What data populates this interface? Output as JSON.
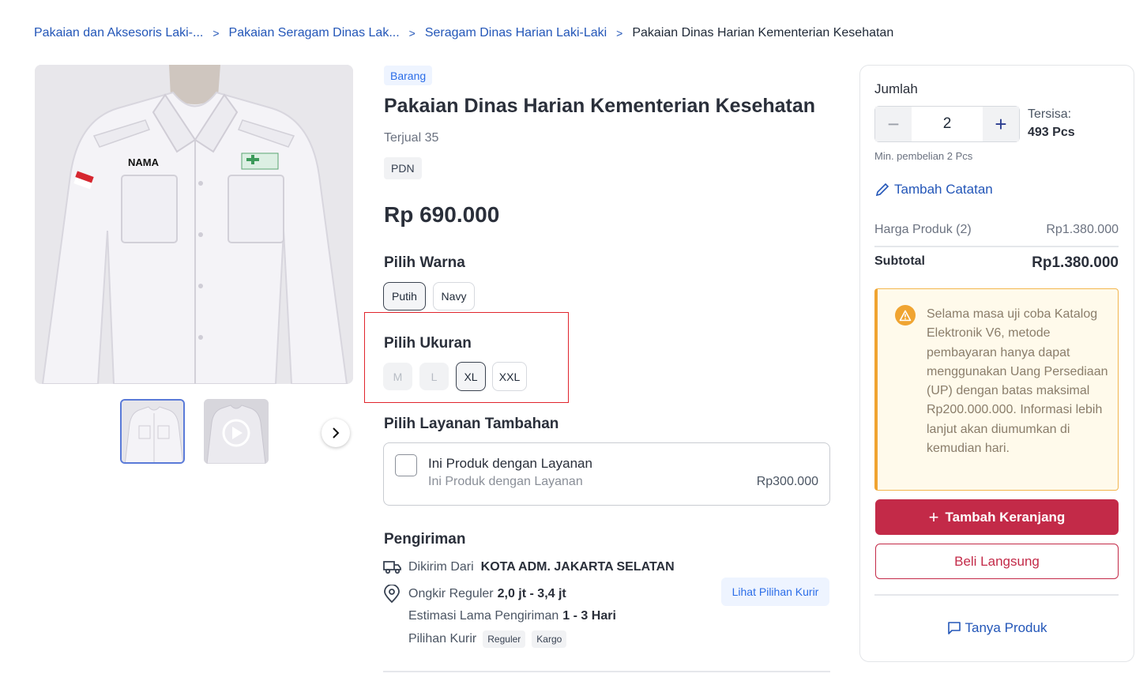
{
  "breadcrumb": {
    "items": [
      "Pakaian dan Aksesoris Laki-...",
      "Pakaian Seragam Dinas Lak...",
      "Seragam Dinas Harian Laki-Laki"
    ],
    "current": "Pakaian Dinas Harian Kementerian Kesehatan",
    "separator": ">"
  },
  "gallery": {
    "image_label": "NAMA",
    "thumbnails": [
      "photo",
      "video"
    ],
    "next_icon": "chevron-right-icon"
  },
  "product": {
    "type_tag": "Barang",
    "title": "Pakaian Dinas Harian Kementerian Kesehatan",
    "sold": "Terjual 35",
    "tag": "PDN",
    "price": "Rp 690.000"
  },
  "color": {
    "label": "Pilih Warna",
    "options": [
      "Putih",
      "Navy"
    ],
    "selected": "Putih"
  },
  "size": {
    "label": "Pilih Ukuran",
    "options": [
      "M",
      "L",
      "XL",
      "XXL"
    ],
    "disabled": [
      "M",
      "L"
    ],
    "selected": "XL"
  },
  "service": {
    "label": "Pilih Layanan Tambahan",
    "name": "Ini Produk dengan Layanan",
    "description": "Ini Produk dengan Layanan",
    "price": "Rp300.000"
  },
  "shipping": {
    "label": "Pengiriman",
    "from_label": "Dikirim Dari",
    "from_value": "KOTA ADM. JAKARTA SELATAN",
    "cost_label": "Ongkir Reguler",
    "cost_value": "2,0 jt - 3,4 jt",
    "estimate_label": "Estimasi Lama Pengiriman",
    "estimate_value": "1 - 3 Hari",
    "courier_label": "Pilihan Kurir",
    "couriers": [
      "Reguler",
      "Kargo"
    ],
    "courier_button": "Lihat Pilihan Kurir"
  },
  "cart": {
    "qty_label": "Jumlah",
    "qty_value": "2",
    "minus": "−",
    "plus": "+",
    "stock_label": "Tersisa:",
    "stock_value": "493 Pcs",
    "min_purchase": "Min. pembelian 2 Pcs",
    "add_note": "Tambah Catatan",
    "product_price_label": "Harga Produk (2)",
    "product_price_value": "Rp1.380.000",
    "subtotal_label": "Subtotal",
    "subtotal_value": "Rp1.380.000",
    "notice": "Selama masa uji coba Katalog Elektronik V6, metode pembayaran hanya dapat menggunakan Uang Persediaan (UP) dengan batas maksimal Rp200.000.000. Informasi lebih lanjut akan diumumkan di kemudian hari.",
    "add_to_cart": "Tambah Keranjang",
    "buy_now": "Beli Langsung",
    "ask_product": "Tanya Produk"
  },
  "colors": {
    "link": "#2356b8",
    "primary": "#c32a48",
    "warning": "#f0a431",
    "highlight": "#e0252d"
  }
}
